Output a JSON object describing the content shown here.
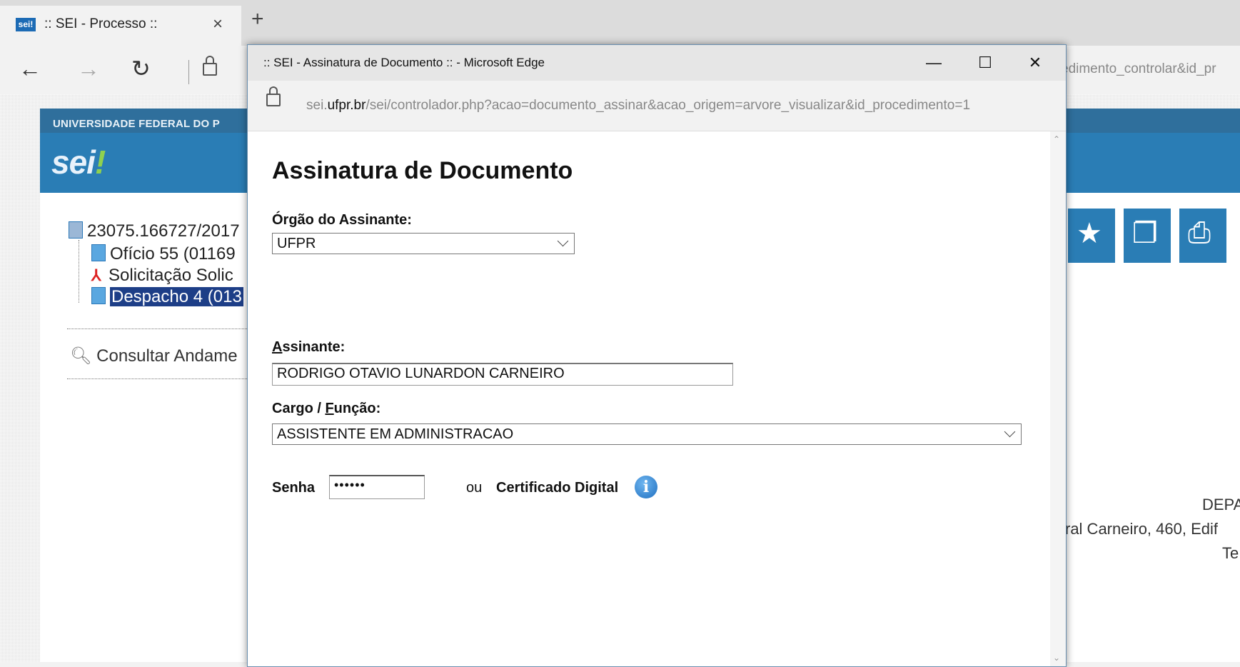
{
  "browser": {
    "tab_favicon_text": "sei!",
    "tab_title": ":: SEI - Processo ::",
    "tab_close": "×",
    "new_tab": "+",
    "back": "←",
    "forward": "→",
    "refresh": "↻",
    "address_partial": "edimento_controlar&id_pr"
  },
  "sei": {
    "org_name": "UNIVERSIDADE FEDERAL DO P",
    "logo": "sei",
    "logo_dot": "!",
    "tree": {
      "process": "23075.166727/2017",
      "items": [
        "Ofício 55 (01169",
        "Solicitação Solic",
        "Despacho 4 (013"
      ]
    },
    "consult_label": "Consultar Andame",
    "right_text": {
      "line1": "DEPA",
      "line2": "ral Carneiro, 460, Edif",
      "line3": "Te"
    }
  },
  "popup": {
    "window_title": ":: SEI - Assinatura de Documento :: - Microsoft Edge",
    "minimize": "—",
    "maximize": "☐",
    "close": "✕",
    "url_host_prefix": "sei.",
    "url_domain": "ufpr.br",
    "url_path": "/sei/controlador.php?acao=documento_assinar&acao_origem=arvore_visualizar&id_procedimento=1",
    "heading": "Assinatura de Documento",
    "orgao_label": "Órgão do Assinante:",
    "orgao_value": "UFPR",
    "assinante_label_first": "A",
    "assinante_label_rest": "ssinante:",
    "assinante_value": "RODRIGO OTAVIO LUNARDON CARNEIRO",
    "cargo_label_pre": "Cargo / ",
    "cargo_label_u": "F",
    "cargo_label_post": "unção:",
    "cargo_value": "ASSISTENTE EM ADMINISTRACAO",
    "senha_label": "Senha",
    "senha_value": "••••••",
    "ou_label": "ou",
    "certificado_label": "Certificado Digital",
    "info_glyph": "i"
  },
  "colors": {
    "sei_header": "#2a7db5",
    "selected_node": "#1d3e87"
  }
}
